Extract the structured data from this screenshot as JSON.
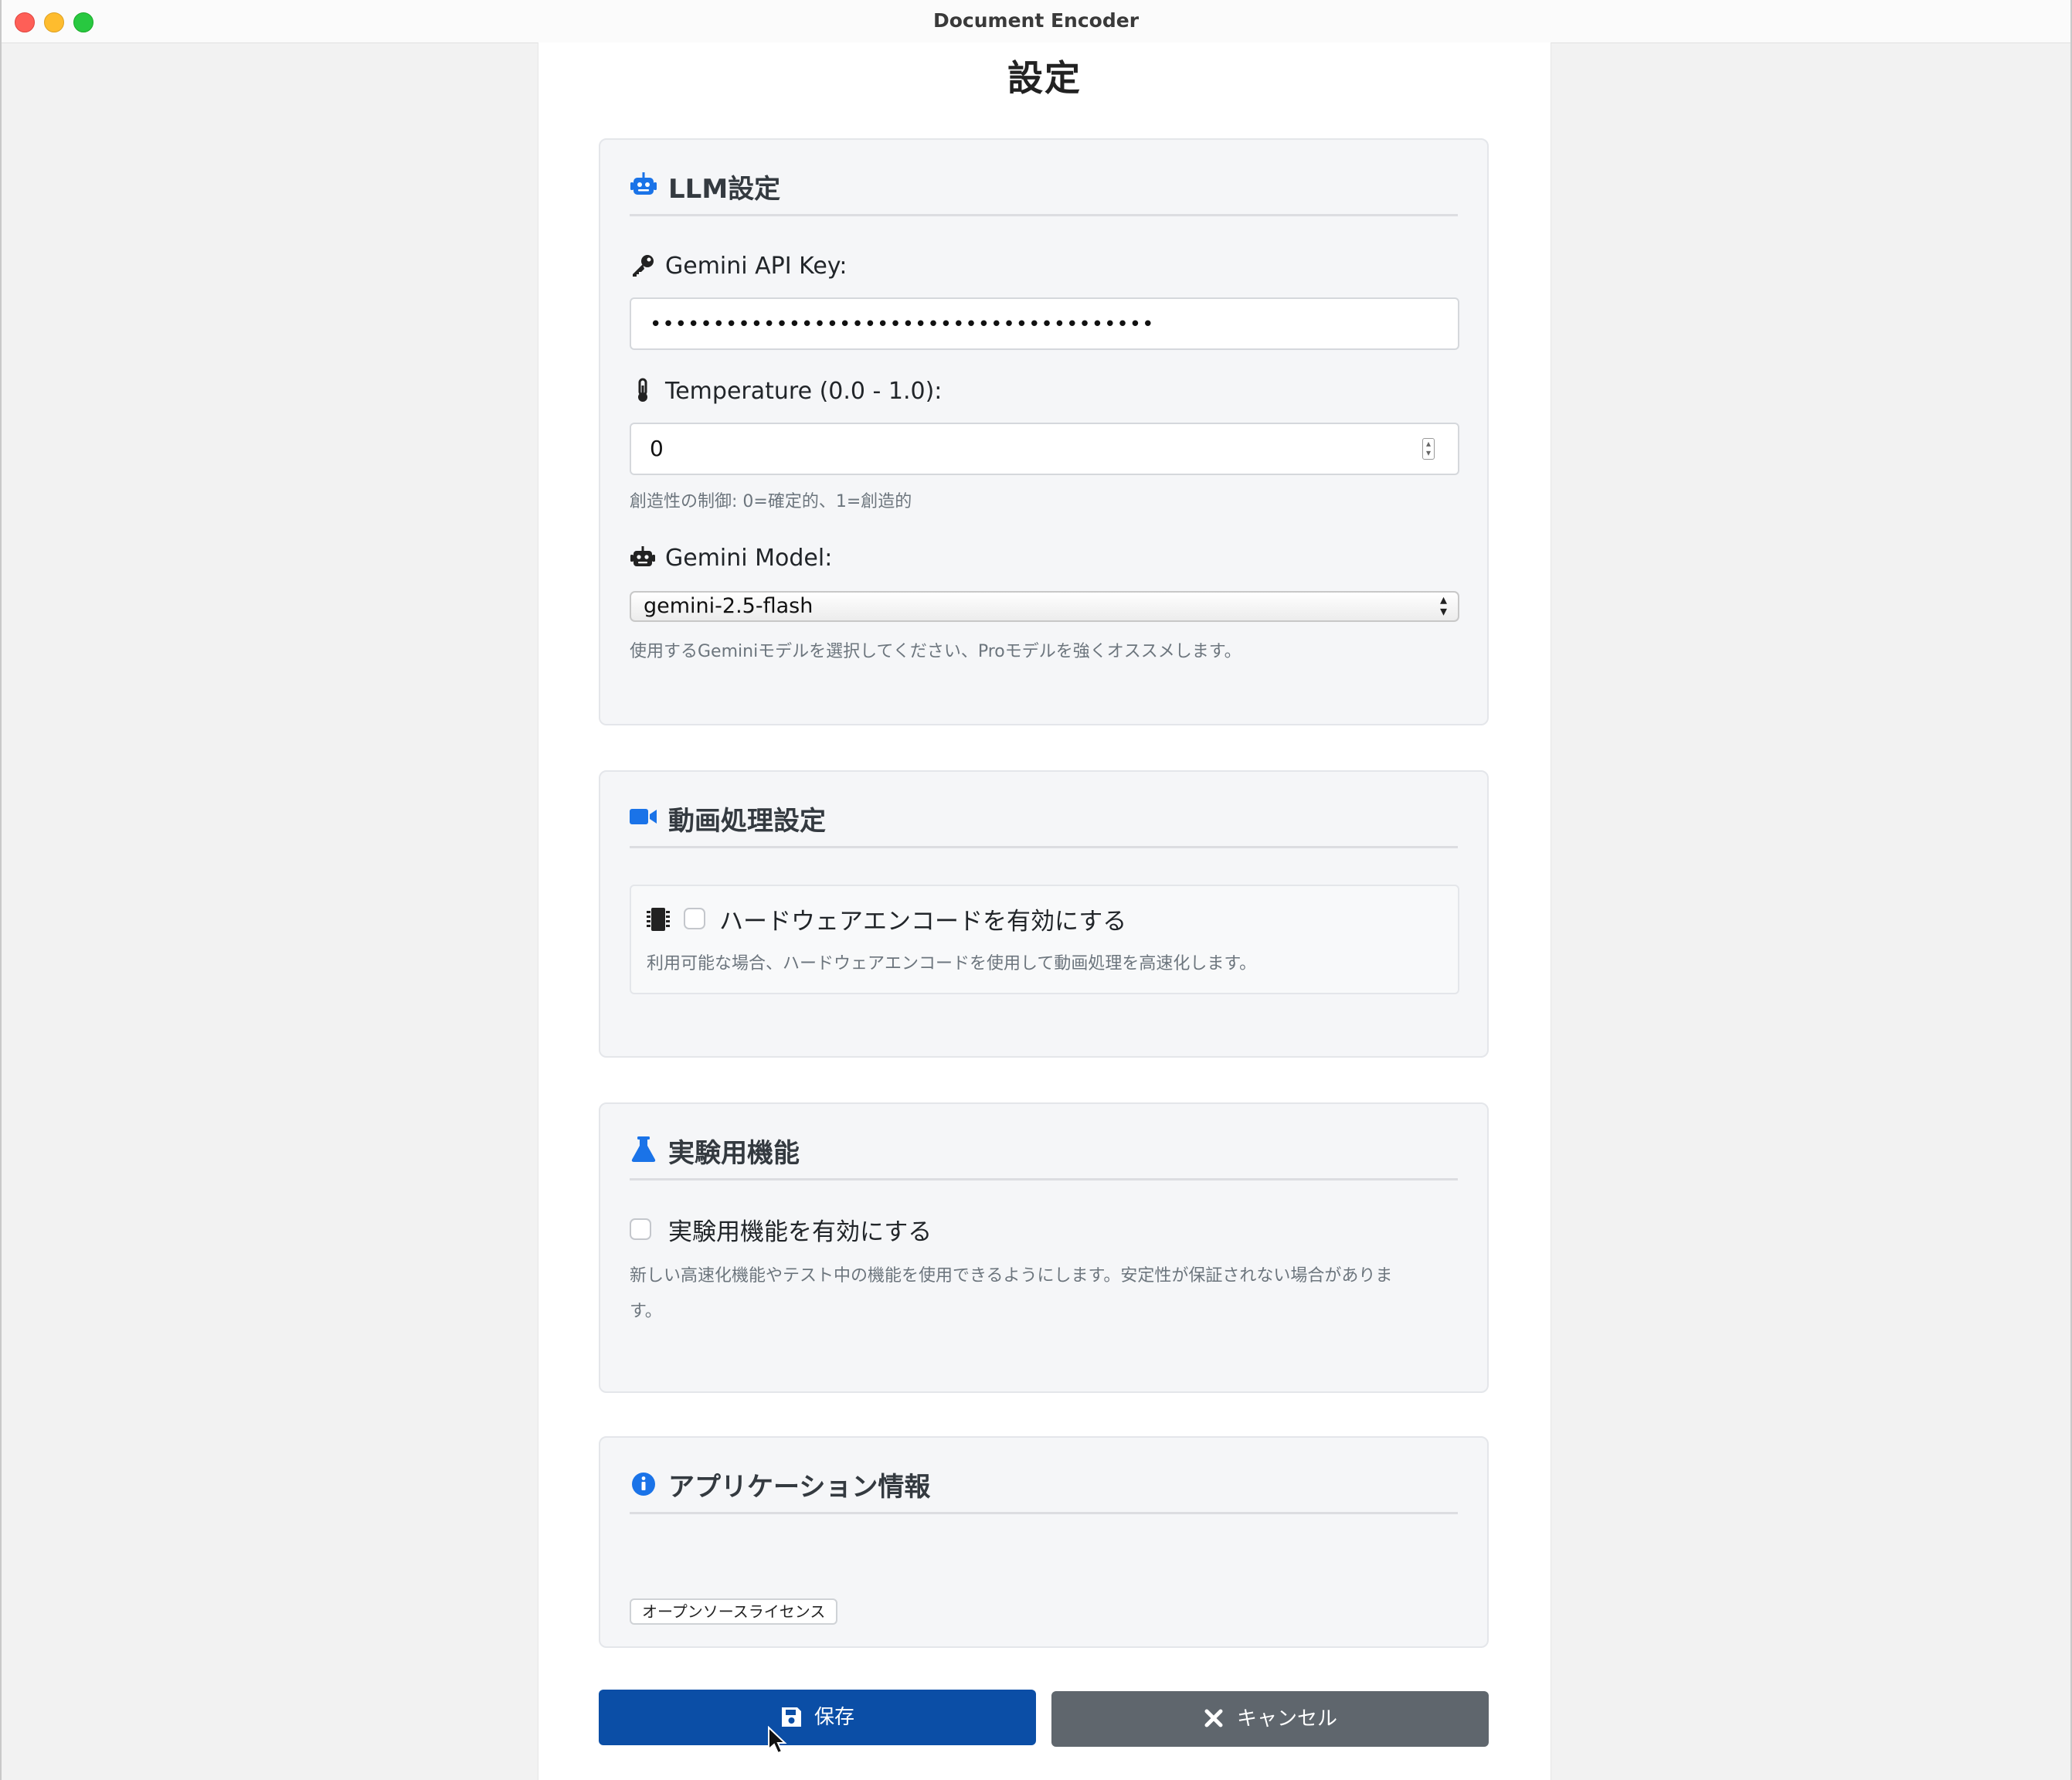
{
  "window": {
    "title": "Document Encoder"
  },
  "page": {
    "title": "設定"
  },
  "llm_section": {
    "heading": "LLM設定",
    "icon": "robot-icon",
    "api_key": {
      "label": "Gemini API Key:",
      "value": "••••••••••••••••••••••••••••••••••••••••"
    },
    "temperature": {
      "label": "Temperature (0.0 - 1.0):",
      "value": "0",
      "help": "創造性の制御: 0=確定的、1=創造的"
    },
    "model": {
      "label": "Gemini Model:",
      "selected": "gemini-2.5-flash",
      "help": "使用するGeminiモデルを選択してください、Proモデルを強くオススメします。"
    }
  },
  "video_section": {
    "heading": "動画処理設定",
    "icon": "video-camera-icon",
    "hw_encode": {
      "label": "ハードウェアエンコードを有効にする",
      "checked": false,
      "help": "利用可能な場合、ハードウェアエンコードを使用して動画処理を高速化します。"
    }
  },
  "experimental_section": {
    "heading": "実験用機能",
    "icon": "flask-icon",
    "enable": {
      "label": "実験用機能を有効にする",
      "checked": false,
      "help_line1": "新しい高速化機能やテスト中の機能を使用できるようにします。安定性が保証されない場合がありま",
      "help_line2": "す。"
    }
  },
  "app_info_section": {
    "heading": "アプリケーション情報",
    "icon": "info-circle-icon",
    "license_button": "オープンソースライセンス"
  },
  "actions": {
    "save_label": "保存",
    "cancel_label": "キャンセル"
  },
  "colors": {
    "accent_icon": "#1a73e8",
    "save_button": "#0b4ea6",
    "cancel_button": "#5f666d",
    "window_bg": "#f2f2f2",
    "card_bg": "#f5f6f8"
  }
}
